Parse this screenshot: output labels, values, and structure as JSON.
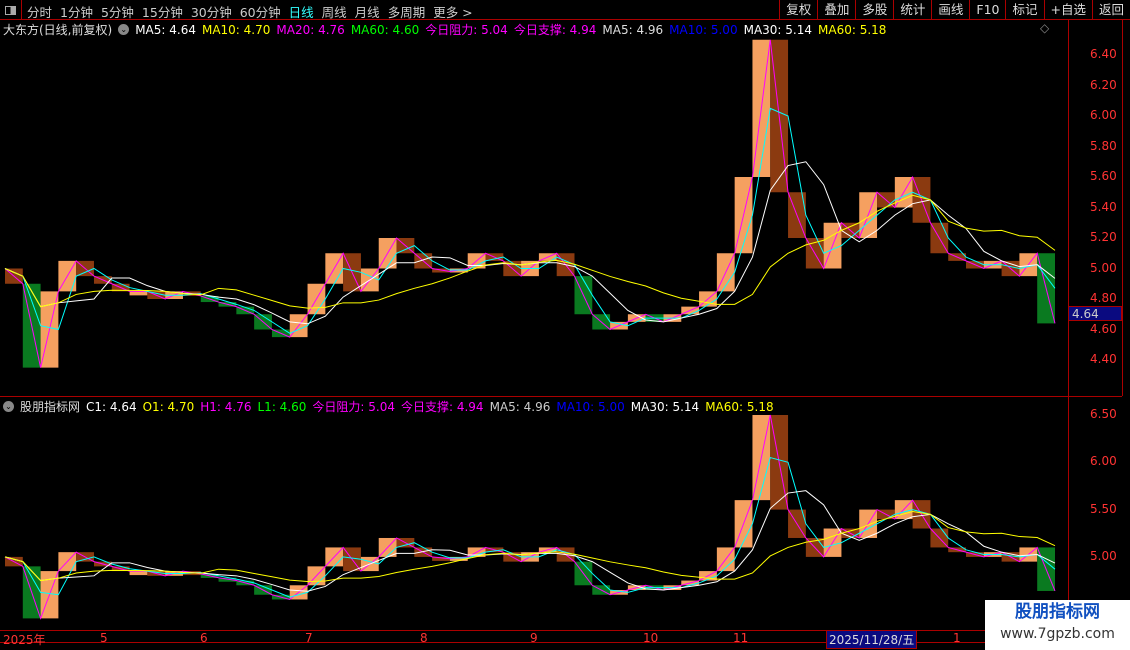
{
  "toolbar": {
    "periods": [
      "分时",
      "1分钟",
      "5分钟",
      "15分钟",
      "30分钟",
      "60分钟",
      "日线",
      "周线",
      "月线",
      "多周期",
      "更多 >"
    ],
    "active": "日线",
    "buttons": [
      "复权",
      "叠加",
      "多股",
      "统计",
      "画线",
      "F10",
      "标记",
      "+自选",
      "返回"
    ]
  },
  "main_info": {
    "title": "大东方(日线,前复权)",
    "items": [
      {
        "t": "MA5: 4.64",
        "c": "#ffffff"
      },
      {
        "t": "MA10: 4.70",
        "c": "#ffff00"
      },
      {
        "t": "MA20: 4.76",
        "c": "#ff00ff"
      },
      {
        "t": "MA60: 4.60",
        "c": "#00ff00"
      },
      {
        "t": "今日阻力: 5.04",
        "c": "#ff00ff"
      },
      {
        "t": "今日支撑: 4.94",
        "c": "#ff00ff"
      },
      {
        "t": "MA5: 4.96",
        "c": "#dddddd"
      },
      {
        "t": "MA10: 5.00",
        "c": "#0000ff"
      },
      {
        "t": "MA30: 5.14",
        "c": "#ffffff"
      },
      {
        "t": "MA60: 5.18",
        "c": "#ffff00"
      }
    ]
  },
  "sub_info": {
    "title": "股朋指标网",
    "items": [
      {
        "t": "C1: 4.64",
        "c": "#ffffff"
      },
      {
        "t": "O1: 4.70",
        "c": "#ffff00"
      },
      {
        "t": "H1: 4.76",
        "c": "#ff00ff"
      },
      {
        "t": "L1: 4.60",
        "c": "#00ff00"
      },
      {
        "t": "今日阻力: 5.04",
        "c": "#ff00ff"
      },
      {
        "t": "今日支撑: 4.94",
        "c": "#ff00ff"
      },
      {
        "t": "MA5: 4.96",
        "c": "#cccccc"
      },
      {
        "t": "MA10: 5.00",
        "c": "#0000ff"
      },
      {
        "t": "MA30: 5.14",
        "c": "#ffffff"
      },
      {
        "t": "MA60: 5.18",
        "c": "#ffff00"
      }
    ]
  },
  "main_axis": [
    "6.40",
    "6.20",
    "6.00",
    "5.80",
    "5.60",
    "5.40",
    "5.20",
    "5.00",
    "4.80",
    "4.60",
    "4.40"
  ],
  "sub_axis": [
    "6.50",
    "6.00",
    "5.50",
    "5.00"
  ],
  "current_price": "4.64",
  "x_axis": [
    "2025年",
    "5",
    "6",
    "7",
    "8",
    "9",
    "10",
    "11",
    "1"
  ],
  "cursor_date": "2025/11/28/五",
  "watermark": {
    "name": "股朋指标网",
    "url": "www.7gpzb.com"
  },
  "chart_data": {
    "type": "line",
    "series": [
      {
        "name": "close",
        "values": [
          5.0,
          4.9,
          4.35,
          4.85,
          5.05,
          4.95,
          4.9,
          4.85,
          4.85,
          4.8,
          4.85,
          4.82,
          4.78,
          4.75,
          4.7,
          4.6,
          4.55,
          4.7,
          4.9,
          5.1,
          4.85,
          5.0,
          5.2,
          5.1,
          5.0,
          4.98,
          5.0,
          5.1,
          5.05,
          4.95,
          5.05,
          5.1,
          4.95,
          4.7,
          4.6,
          4.65,
          4.7,
          4.65,
          4.7,
          4.75,
          4.85,
          5.1,
          5.6,
          6.5,
          5.5,
          5.2,
          5.0,
          5.3,
          5.2,
          5.5,
          5.4,
          5.6,
          5.3,
          5.1,
          5.05,
          5.0,
          5.05,
          4.95,
          5.1,
          4.64
        ]
      }
    ]
  }
}
